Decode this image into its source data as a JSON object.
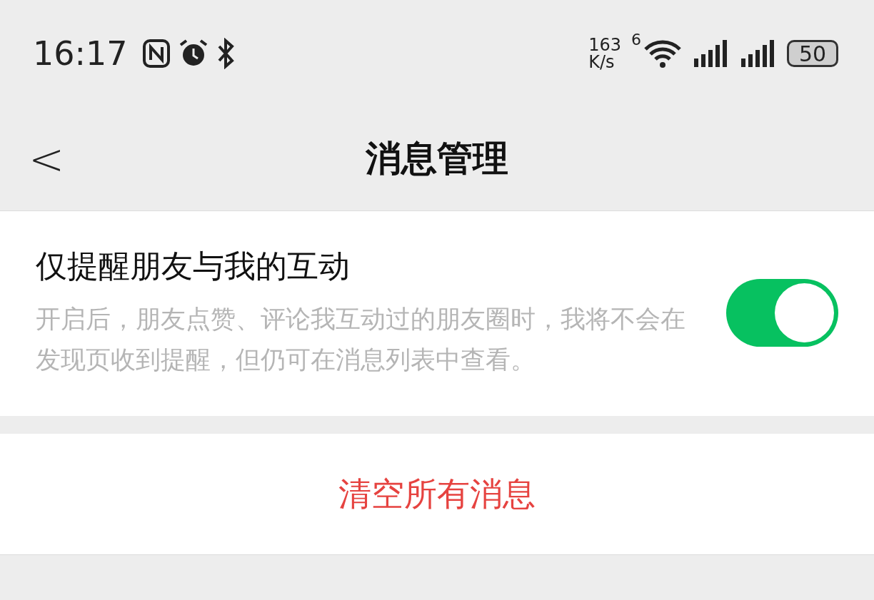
{
  "status_bar": {
    "time": "16:17",
    "speed_value": "163",
    "speed_unit": "K/s",
    "wifi_generation": "6",
    "battery": "50"
  },
  "header": {
    "back": "<",
    "title": "消息管理"
  },
  "setting": {
    "title": "仅提醒朋友与我的互动",
    "description": "开启后，朋友点赞、评论我互动过的朋友圈时，我将不会在发现页收到提醒，但仍可在消息列表中查看。",
    "on": true
  },
  "action": {
    "label": "清空所有消息"
  }
}
